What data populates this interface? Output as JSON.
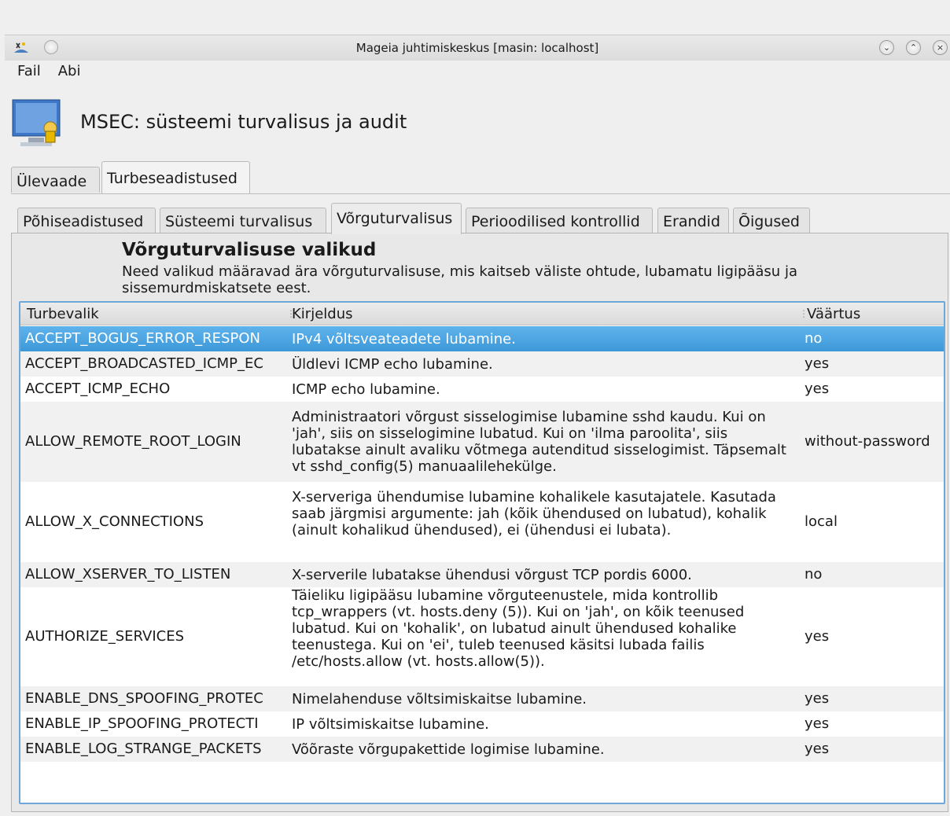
{
  "window": {
    "title": "Mageia juhtimiskeskus  [masin: localhost]",
    "buttons": {
      "minimize": "⌄",
      "maximize": "⌃",
      "close": "×"
    }
  },
  "menu": {
    "file": "Fail",
    "help": "Abi"
  },
  "header": {
    "title": "MSEC: süsteemi turvalisus ja audit"
  },
  "outer_tabs": [
    "Ülevaade",
    "Turbeseadistused"
  ],
  "outer_tab_active": 1,
  "inner_tabs": [
    "Põhiseadistused",
    "Süsteemi turvalisus",
    "Võrguturvalisus",
    "Perioodilised kontrollid",
    "Erandid",
    "Õigused"
  ],
  "inner_tab_active": 2,
  "section": {
    "title": "Võrguturvalisuse valikud",
    "description": "Need valikud määravad ära võrguturvalisuse, mis kaitseb väliste ohtude, lubamatu ligipääsu ja sissemurdmiskatsete eest."
  },
  "table": {
    "columns": [
      "Turbevalik",
      "Kirjeldus",
      "Väärtus"
    ],
    "rows": [
      {
        "option": "ACCEPT_BOGUS_ERROR_RESPON",
        "description": "IPv4 võltsveateadete lubamine.",
        "value": "no",
        "selected": true
      },
      {
        "option": "ACCEPT_BROADCASTED_ICMP_EC",
        "description": "Üldlevi ICMP echo lubamine.",
        "value": "yes"
      },
      {
        "option": "ACCEPT_ICMP_ECHO",
        "description": "ICMP echo lubamine.",
        "value": "yes"
      },
      {
        "option": "ALLOW_REMOTE_ROOT_LOGIN",
        "description": "Administraatori võrgust sisselogimise lubamine sshd kaudu. Kui on 'jah', siis on sisselogimine lubatud. Kui on 'ilma paroolita', siis lubatakse ainult avaliku võtmega autenditud sisselogimist. Täpsemalt vt sshd_config(5) manuaalilehekülge.",
        "value": "without-password"
      },
      {
        "option": "ALLOW_X_CONNECTIONS",
        "description": "X-serveriga ühendumise lubamine kohalikele kasutajatele. Kasutada saab järgmisi argumente: jah (kõik ühendused on lubatud), kohalik (ainult kohalikud ühendused), ei (ühendusi ei lubata).",
        "value": "local"
      },
      {
        "option": "ALLOW_XSERVER_TO_LISTEN",
        "description": "X-serverile lubatakse ühendusi võrgust TCP pordis 6000.",
        "value": "no"
      },
      {
        "option": "AUTHORIZE_SERVICES",
        "description": "Täieliku ligipääsu lubamine võrguteenustele, mida kontrollib tcp_wrappers (vt. hosts.deny (5)). Kui on 'jah', on kõik teenused lubatud. Kui on 'kohalik', on lubatud ainult ühendused kohalike teenustega. Kui on 'ei', tuleb teenused käsitsi lubada failis /etc/hosts.allow (vt. hosts.allow(5)).",
        "value": "yes"
      },
      {
        "option": "ENABLE_DNS_SPOOFING_PROTEC",
        "description": "Nimelahenduse võltsimiskaitse lubamine.",
        "value": "yes"
      },
      {
        "option": "ENABLE_IP_SPOOFING_PROTECTI",
        "description": "IP võltsimiskaitse lubamine.",
        "value": "yes"
      },
      {
        "option": "ENABLE_LOG_STRANGE_PACKETS",
        "description": "Võõraste võrgupakettide logimise lubamine.",
        "value": "yes"
      }
    ]
  },
  "colors": {
    "selection": "#3d98d8",
    "table_border": "#6ea8d8"
  }
}
